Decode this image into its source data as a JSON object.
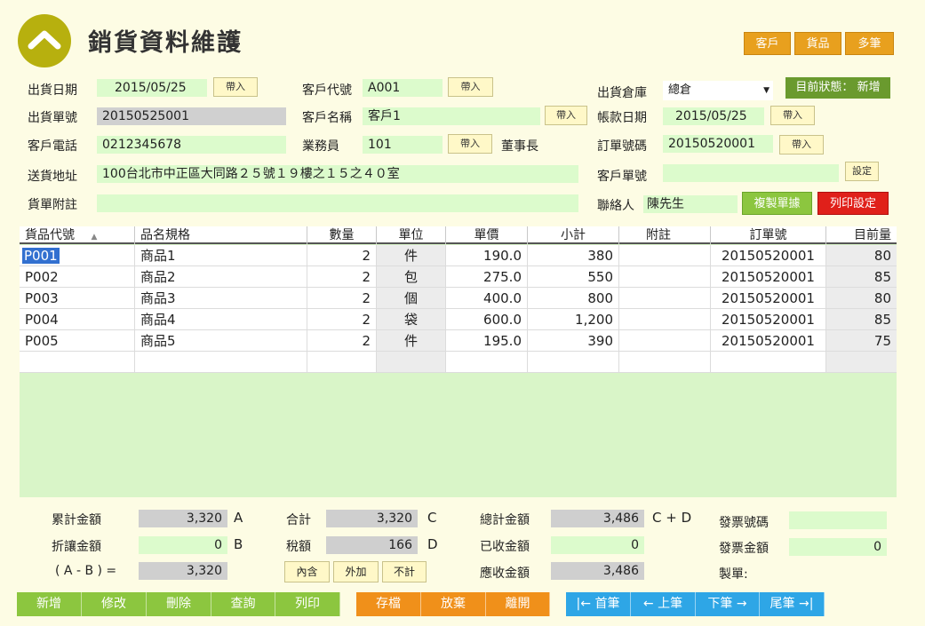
{
  "header": {
    "title": "銷貨資料維護",
    "nav_buttons": [
      "客戶",
      "貨品",
      "多筆"
    ]
  },
  "status": {
    "label": "目前狀態：",
    "value": "新增"
  },
  "form": {
    "ship_date_label": "出貨日期",
    "ship_date": "2015/05/25",
    "ship_no_label": "出貨單號",
    "ship_no": "20150525001",
    "cust_phone_label": "客戶電話",
    "cust_phone": "0212345678",
    "address_label": "送貨地址",
    "address": "100台北市中正區大同路２５號１９樓之１５之４０室",
    "note_label": "貨單附註",
    "note": "",
    "cust_code_label": "客戶代號",
    "cust_code": "A001",
    "cust_name_label": "客戶名稱",
    "cust_name": "客戶1",
    "sales_label": "業務員",
    "sales": "101",
    "sales_title": "董事長",
    "warehouse_label": "出貨倉庫",
    "warehouse": "總倉",
    "bill_date_label": "帳款日期",
    "bill_date": "2015/05/25",
    "order_no_label": "訂單號碼",
    "order_no": "20150520001",
    "cust_order_label": "客戶單號",
    "cust_order": "",
    "contact_label": "聯絡人",
    "contact": "陳先生",
    "import_label": "帶入",
    "setting_label": "設定",
    "copy_label": "複製單據",
    "print_setting_label": "列印設定"
  },
  "table": {
    "columns": [
      "貨品代號",
      "品名規格",
      "數量",
      "單位",
      "單價",
      "小計",
      "附註",
      "訂單號",
      "目前量"
    ],
    "rows": [
      [
        "P001",
        "商品1",
        "2",
        "件",
        "190.0",
        "380",
        "",
        "20150520001",
        "80"
      ],
      [
        "P002",
        "商品2",
        "2",
        "包",
        "275.0",
        "550",
        "",
        "20150520001",
        "85"
      ],
      [
        "P003",
        "商品3",
        "2",
        "個",
        "400.0",
        "800",
        "",
        "20150520001",
        "80"
      ],
      [
        "P004",
        "商品4",
        "2",
        "袋",
        "600.0",
        "1,200",
        "",
        "20150520001",
        "85"
      ],
      [
        "P005",
        "商品5",
        "2",
        "件",
        "195.0",
        "390",
        "",
        "20150520001",
        "75"
      ]
    ]
  },
  "summary": {
    "cum_label": "累計金額",
    "cum": "3,320",
    "cum_sfx": "A",
    "discount_label": "折讓金額",
    "discount": "0",
    "discount_sfx": "B",
    "ab_label": "( A - B ) =",
    "ab": "3,320",
    "total_label": "合計",
    "total": "3,320",
    "total_sfx": "C",
    "tax_label": "稅額",
    "tax": "166",
    "tax_sfx": "D",
    "tax_buttons": [
      "內含",
      "外加",
      "不計"
    ],
    "grand_label": "總計金額",
    "grand": "3,486",
    "grand_sfx": "C + D",
    "received_label": "已收金額",
    "received": "0",
    "receivable_label": "應收金額",
    "receivable": "3,486",
    "invoice_no_label": "發票號碼",
    "invoice_no": "",
    "invoice_amt_label": "發票金額",
    "invoice_amt": "0",
    "maker_label": "製單:"
  },
  "toolbar": {
    "crud": [
      "新增",
      "修改",
      "刪除",
      "查詢",
      "列印"
    ],
    "save": [
      "存檔",
      "放棄",
      "離開"
    ],
    "nav": [
      "|← 首筆",
      "← 上筆",
      "下筆 →",
      "尾筆 →|"
    ]
  },
  "colors": {
    "accent_green": "#8cc63f",
    "accent_orange": "#f0901a",
    "accent_blue": "#2ea6e6",
    "field_green": "#dcfbcc",
    "logo": "#b7b00e"
  }
}
